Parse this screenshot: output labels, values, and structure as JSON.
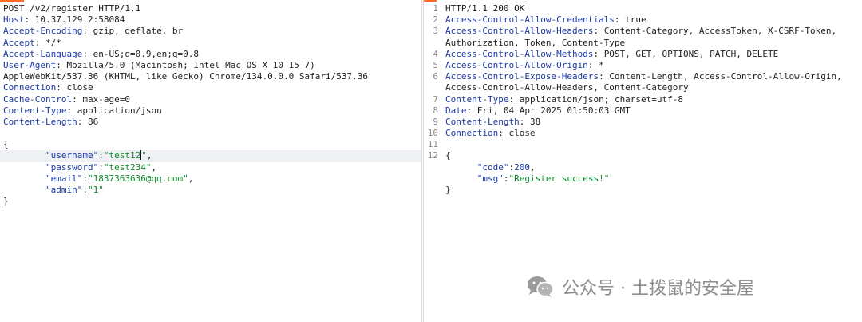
{
  "request": {
    "request_line": "POST /v2/register HTTP/1.1",
    "headers": [
      {
        "name": "Host",
        "value": "10.37.129.2:58084"
      },
      {
        "name": "Accept-Encoding",
        "value": "gzip, deflate, br"
      },
      {
        "name": "Accept",
        "value": "*/*"
      },
      {
        "name": "Accept-Language",
        "value": "en-US;q=0.9,en;q=0.8"
      },
      {
        "name": "User-Agent",
        "value": "Mozilla/5.0 (Macintosh; Intel Mac OS X 10_15_7)"
      },
      {
        "name": "",
        "value": "AppleWebKit/537.36 (KHTML, like Gecko) Chrome/134.0.0.0 Safari/537.36"
      },
      {
        "name": "Connection",
        "value": "close"
      },
      {
        "name": "Cache-Control",
        "value": "max-age=0"
      },
      {
        "name": "Content-Type",
        "value": "application/json"
      },
      {
        "name": "Content-Length",
        "value": "86"
      }
    ],
    "body": {
      "open": "{",
      "close": "}",
      "fields": [
        {
          "key": "\"username\"",
          "value": "\"test12\"",
          "suffix": ","
        },
        {
          "key": "\"password\"",
          "value": "\"test234\"",
          "suffix": ","
        },
        {
          "key": "\"email\"",
          "value": "\"1837363636@qq.com\"",
          "suffix": ","
        },
        {
          "key": "\"admin\"",
          "value": "\"1\"",
          "suffix": ""
        }
      ]
    }
  },
  "response": {
    "lines": [
      {
        "num": "1",
        "name": "",
        "value": "HTTP/1.1 200 OK"
      },
      {
        "num": "2",
        "name": "Access-Control-Allow-Credentials",
        "value": "true"
      },
      {
        "num": "3",
        "name": "Access-Control-Allow-Headers",
        "value": "Content-Category, AccessToken, X-CSRF-Token,"
      },
      {
        "num": "",
        "name": "",
        "value": "Authorization, Token, Content-Type"
      },
      {
        "num": "4",
        "name": "Access-Control-Allow-Methods",
        "value": "POST, GET, OPTIONS, PATCH, DELETE"
      },
      {
        "num": "5",
        "name": "Access-Control-Allow-Origin",
        "value": "*"
      },
      {
        "num": "6",
        "name": "Access-Control-Expose-Headers",
        "value": "Content-Length, Access-Control-Allow-Origin,"
      },
      {
        "num": "",
        "name": "",
        "value": "Access-Control-Allow-Headers, Content-Category"
      },
      {
        "num": "7",
        "name": "Content-Type",
        "value": "application/json; charset=utf-8"
      },
      {
        "num": "8",
        "name": "Date",
        "value": "Fri, 04 Apr 2025 01:50:03 GMT"
      },
      {
        "num": "9",
        "name": "Content-Length",
        "value": "38"
      },
      {
        "num": "10",
        "name": "Connection",
        "value": "close"
      },
      {
        "num": "11",
        "name": "",
        "value": ""
      }
    ],
    "body": {
      "line_num": "12",
      "open": "{",
      "close": "}",
      "fields": [
        {
          "key": "\"code\"",
          "value": "200",
          "suffix": ",",
          "type": "number"
        },
        {
          "key": "\"msg\"",
          "value": "\"Register success!\"",
          "suffix": "",
          "type": "string"
        }
      ]
    }
  },
  "watermark": {
    "text": "公众号 · 土拨鼠的安全屋",
    "icon": "wechat-icon"
  },
  "colors": {
    "accent": "#ff6a1f",
    "header_name": "#1b39a6",
    "json_string": "#0e8a2d",
    "highlight": "#eef0f3"
  }
}
